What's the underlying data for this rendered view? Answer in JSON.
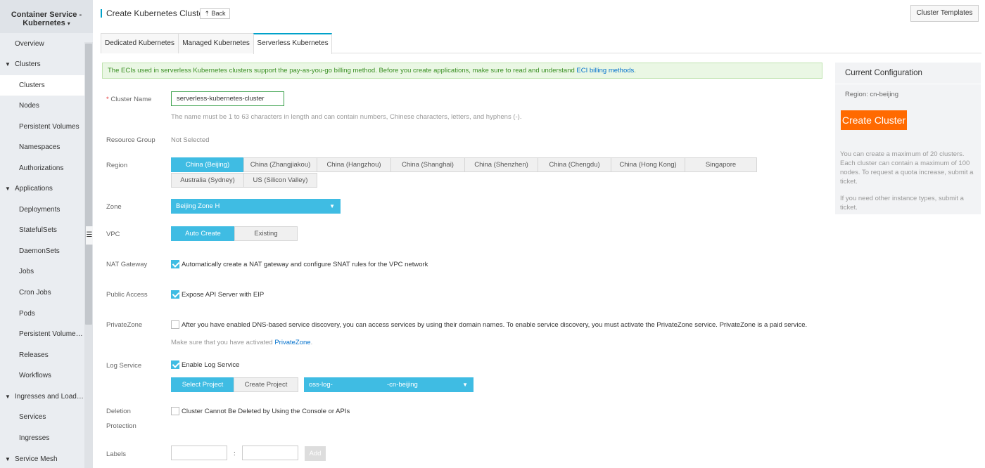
{
  "sidebar": {
    "brand": "Container Service - Kubernetes",
    "brand_caret": "▾",
    "items": [
      {
        "label": "Overview",
        "level": 1
      },
      {
        "label": "Clusters",
        "level": 1,
        "section": true
      },
      {
        "label": "Clusters",
        "level": 2,
        "active": true
      },
      {
        "label": "Nodes",
        "level": 2
      },
      {
        "label": "Persistent Volumes",
        "level": 2
      },
      {
        "label": "Namespaces",
        "level": 2
      },
      {
        "label": "Authorizations",
        "level": 2
      },
      {
        "label": "Applications",
        "level": 1,
        "section": true
      },
      {
        "label": "Deployments",
        "level": 2
      },
      {
        "label": "StatefulSets",
        "level": 2
      },
      {
        "label": "DaemonSets",
        "level": 2
      },
      {
        "label": "Jobs",
        "level": 2
      },
      {
        "label": "Cron Jobs",
        "level": 2
      },
      {
        "label": "Pods",
        "level": 2
      },
      {
        "label": "Persistent Volume Cl...",
        "level": 2
      },
      {
        "label": "Releases",
        "level": 2
      },
      {
        "label": "Workflows",
        "level": 2
      },
      {
        "label": "Ingresses and Load B...",
        "level": 1,
        "section": true
      },
      {
        "label": "Services",
        "level": 2
      },
      {
        "label": "Ingresses",
        "level": 2
      },
      {
        "label": "Service Mesh",
        "level": 1,
        "section": true
      }
    ],
    "toggle_icon": "list-collapse-icon"
  },
  "header": {
    "title": "Create Kubernetes Cluster",
    "back_label": "Back",
    "back_icon": "arrow-up-icon",
    "templates_label": "Cluster Templates"
  },
  "tabs": [
    {
      "label": "Dedicated Kubernetes"
    },
    {
      "label": "Managed Kubernetes"
    },
    {
      "label": "Serverless Kubernetes",
      "active": true
    }
  ],
  "notice": {
    "text": "The ECIs used in serverless Kubernetes clusters support the pay-as-you-go billing method. Before you create applications, make sure to read and understand",
    "link": "ECI billing methods",
    "end": "."
  },
  "form": {
    "cluster_name": {
      "required_mark": "*",
      "label": "Cluster Name",
      "value": "serverless-kubernetes-cluster",
      "hint": "The name must be 1 to 63 characters in length and can contain numbers, Chinese characters, letters, and hyphens (-)."
    },
    "resource_group": {
      "label": "Resource Group",
      "value": "Not Selected"
    },
    "region": {
      "label": "Region",
      "options": [
        "China (Beijing)",
        "China (Zhangjiakou)",
        "China (Hangzhou)",
        "China (Shanghai)",
        "China (Shenzhen)",
        "China (Chengdu)",
        "China (Hong Kong)",
        "Singapore",
        "Australia (Sydney)",
        "US (Silicon Valley)"
      ],
      "selected": "China (Beijing)"
    },
    "zone": {
      "label": "Zone",
      "value": "Beijing Zone H"
    },
    "vpc": {
      "label": "VPC",
      "options": [
        "Auto Create",
        "Existing"
      ],
      "selected": "Auto Create"
    },
    "nat_gateway": {
      "label": "NAT Gateway",
      "checked": true,
      "text": "Automatically create a NAT gateway and configure SNAT rules for the VPC network"
    },
    "public_access": {
      "label": "Public Access",
      "checked": true,
      "text": "Expose API Server with EIP"
    },
    "private_zone": {
      "label": "PrivateZone",
      "checked": false,
      "text": "After you have enabled DNS-based service discovery, you can access services by using their domain names. To enable service discovery, you must activate the PrivateZone service. PrivateZone is a paid service.",
      "hint": "Make sure that you have activated",
      "hint_link": "PrivateZone",
      "hint_end": "."
    },
    "log_service": {
      "label": "Log Service",
      "checked": true,
      "text": "Enable Log Service",
      "select_project_label": "Select Project",
      "create_project_label": "Create Project",
      "project_prefix": "oss-log-",
      "project_suffix": "-cn-beijing"
    },
    "deletion_protection": {
      "label_line1": "Deletion",
      "label_line2": "Protection",
      "checked": false,
      "text": "Cluster Cannot Be Deleted by Using the Console or APIs"
    },
    "labels": {
      "label": "Labels",
      "separator": ":",
      "key_value": "",
      "value_value": "",
      "add_label": "Add"
    }
  },
  "panel": {
    "title": "Current Configuration",
    "region_text": "Region: cn-beijing",
    "create_label": "Create Cluster",
    "note1": "You can create a maximum of 20 clusters. Each cluster can contain a maximum of 100 nodes. To request a quota increase, submit a ticket.",
    "note2": "If you need other instance types, submit a ticket."
  },
  "colors": {
    "accent": "#3fbce3",
    "primary_orange": "#ff6a00",
    "notice_green": "#3a8f23",
    "link": "#0070cc"
  }
}
